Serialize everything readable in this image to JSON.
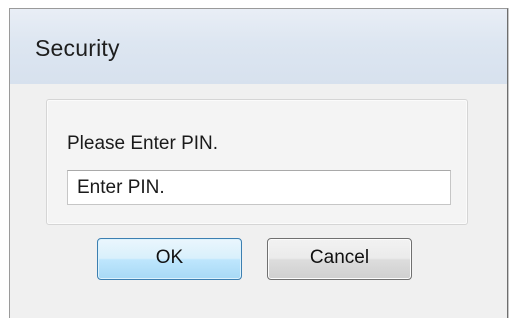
{
  "window": {
    "title": "Security"
  },
  "dialog": {
    "prompt": "Please Enter PIN.",
    "pin_input": {
      "value": "",
      "placeholder": "Enter PIN."
    },
    "ok_label": "OK",
    "cancel_label": "Cancel"
  },
  "colors": {
    "titlebar": "#dde6f1",
    "client_background": "#f0f0f0",
    "default_button_border": "#3c7fb1",
    "default_button_fill": "#bee6fd"
  }
}
